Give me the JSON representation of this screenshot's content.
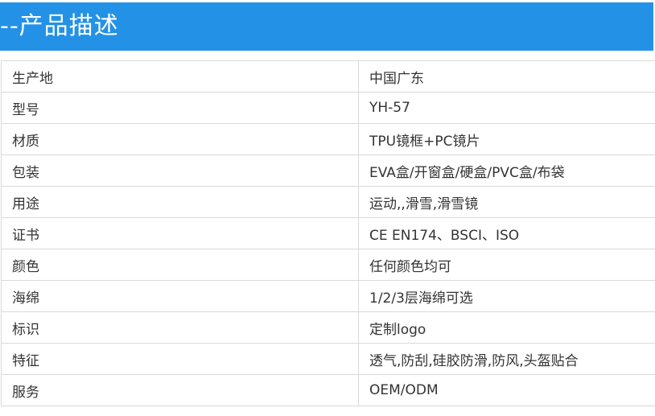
{
  "header": {
    "title": "--产品描述"
  },
  "spec_rows": [
    {
      "label": "生产地",
      "value": "中国广东"
    },
    {
      "label": "型号",
      "value": "YH-57"
    },
    {
      "label": "材质",
      "value": "TPU镜框+PC镜片"
    },
    {
      "label": "包装",
      "value": "EVA盒/开窗盒/硬盒/PVC盒/布袋"
    },
    {
      "label": "用途",
      "value": "运动,,滑雪,滑雪镜"
    },
    {
      "label": "证书",
      "value": "CE EN174、BSCI、ISO"
    },
    {
      "label": "颜色",
      "value": "任何颜色均可"
    },
    {
      "label": "海绵",
      "value": "1/2/3层海绵可选"
    },
    {
      "label": "标识",
      "value": "定制logo"
    },
    {
      "label": "特征",
      "value": "透气,防刮,硅胶防滑,防风,头盔贴合"
    },
    {
      "label": "服务",
      "value": "OEM/ODM"
    }
  ],
  "colors": {
    "header_bg": "#2392e6",
    "header_text": "#ffffff",
    "border": "#d9d9d9",
    "text": "#333333"
  }
}
